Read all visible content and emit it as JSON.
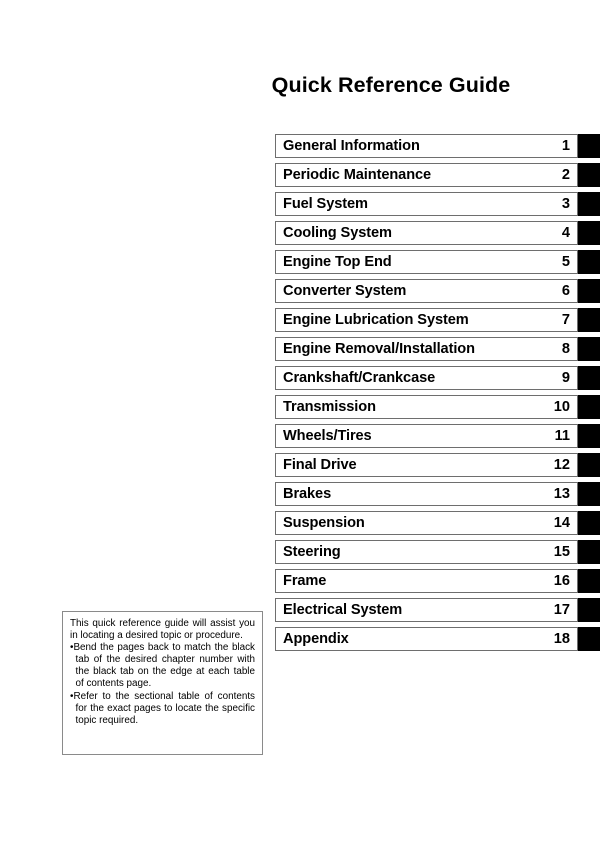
{
  "document": {
    "title": "Quick Reference Guide"
  },
  "chapter_index": {
    "rows": [
      {
        "label": "General Information",
        "number": "1"
      },
      {
        "label": "Periodic Maintenance",
        "number": "2"
      },
      {
        "label": "Fuel System",
        "number": "3"
      },
      {
        "label": "Cooling System",
        "number": "4"
      },
      {
        "label": "Engine Top End",
        "number": "5"
      },
      {
        "label": "Converter System",
        "number": "6"
      },
      {
        "label": "Engine Lubrication System",
        "number": "7"
      },
      {
        "label": "Engine Removal/Installation",
        "number": "8"
      },
      {
        "label": "Crankshaft/Crankcase",
        "number": "9"
      },
      {
        "label": "Transmission",
        "number": "10"
      },
      {
        "label": "Wheels/Tires",
        "number": "11"
      },
      {
        "label": "Final Drive",
        "number": "12"
      },
      {
        "label": "Brakes",
        "number": "13"
      },
      {
        "label": "Suspension",
        "number": "14"
      },
      {
        "label": "Steering",
        "number": "15"
      },
      {
        "label": "Frame",
        "number": "16"
      },
      {
        "label": "Electrical System",
        "number": "17"
      },
      {
        "label": "Appendix",
        "number": "18"
      }
    ]
  },
  "note_box": {
    "intro": "This quick reference guide will assist you in locating a desired topic or procedure.",
    "bullets": [
      "Bend the pages back to match the black tab of the desired chapter number with the black tab on the edge at each table of contents page.",
      "Refer to the sectional table of contents for the exact pages to locate the specific topic required."
    ],
    "bullet_marker": "•"
  },
  "colors": {
    "page_background": "#ffffff",
    "text": "#000000",
    "tab_black": "#000000",
    "box_border": "#6e6e6e",
    "note_border": "#8a8a8a"
  }
}
